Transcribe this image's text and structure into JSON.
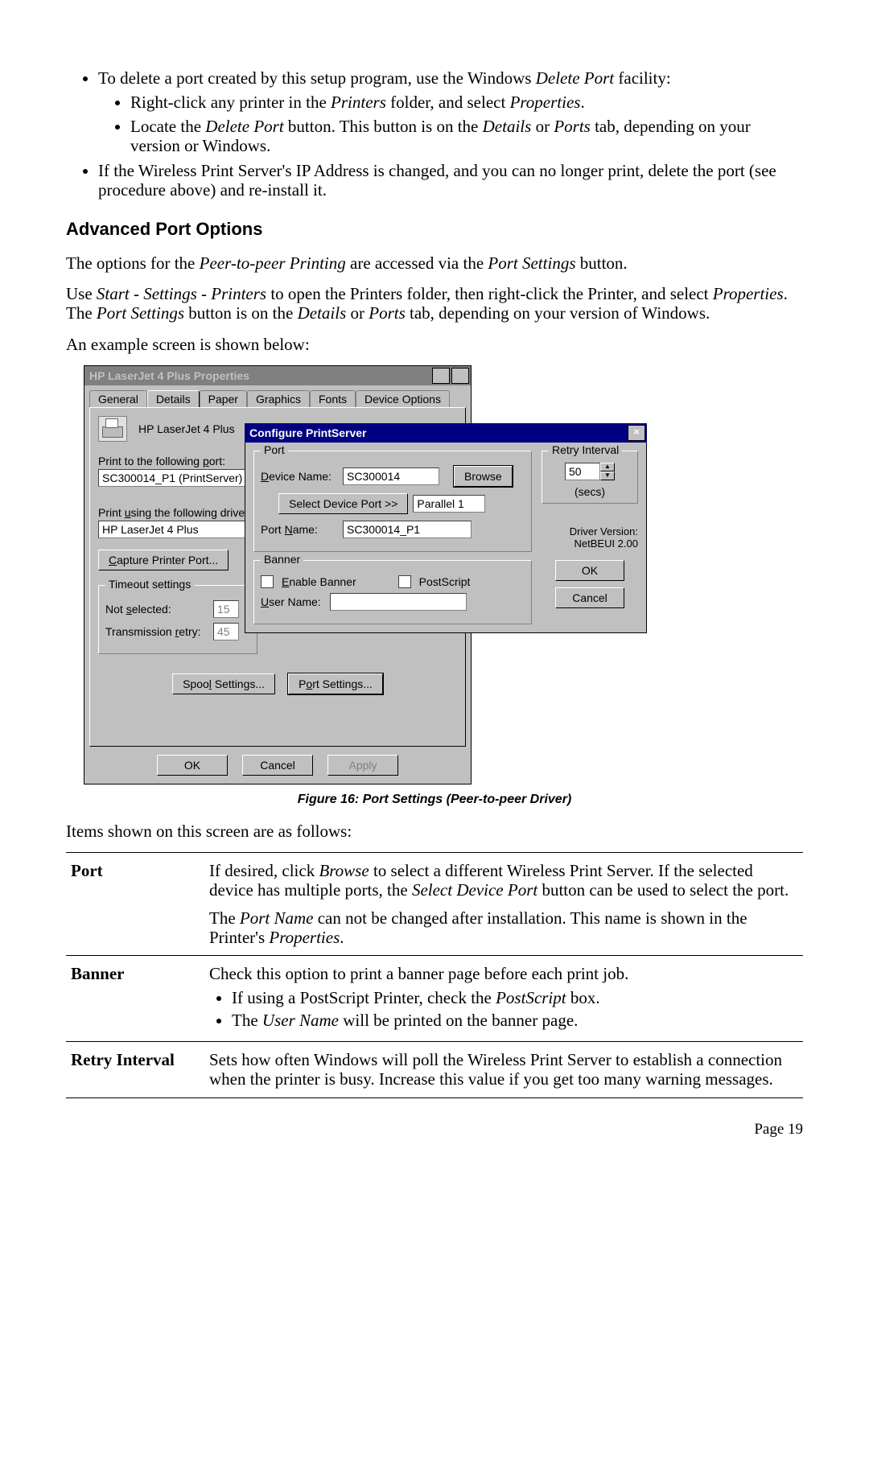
{
  "top_list": {
    "item1_pre": "To delete a port created by this setup program, use the Windows ",
    "item1_it": "Delete Port",
    "item1_post": " facility:",
    "sub1_pre": "Right-click any printer in the ",
    "sub1_it1": "Printers",
    "sub1_mid": " folder, and select ",
    "sub1_it2": "Properties",
    "sub1_post": ".",
    "sub2_pre": "Locate the ",
    "sub2_it1": "Delete Port",
    "sub2_mid1": " button. This button is on the ",
    "sub2_it2": "Details",
    "sub2_mid2": " or ",
    "sub2_it3": "Ports",
    "sub2_post": " tab, depending on your version or Windows.",
    "item2": "If the Wireless Print Server's IP Address is changed, and you can no longer print, delete the port (see procedure above) and re-install it."
  },
  "section_heading": "Advanced Port Options",
  "para1_pre": "The options for the ",
  "para1_it1": "Peer-to-peer Printing",
  "para1_mid": " are accessed via the ",
  "para1_it2": "Port Settings",
  "para1_post": " button.",
  "para2_pre": "Use ",
  "para2_it1": "Start - Settings - Printers",
  "para2_mid1": " to open the Printers folder, then right-click the Printer, and select ",
  "para2_it2": "Properties",
  "para2_mid2": ". The ",
  "para2_it3": "Port Settings",
  "para2_mid3": " button is on the ",
  "para2_it4": "Details",
  "para2_mid4": " or ",
  "para2_it5": "Ports",
  "para2_post": " tab, depending on your version of Windows.",
  "para3": "An example screen is shown below:",
  "props_window": {
    "title": "HP LaserJet 4 Plus Properties",
    "help_btn": "?",
    "close_btn": "×",
    "tabs": [
      "General",
      "Details",
      "Paper",
      "Graphics",
      "Fonts",
      "Device Options"
    ],
    "printer_name": "HP LaserJet 4 Plus",
    "print_to_label": "Print to the following port:",
    "print_to_value": "SC300014_P1 (PrintServer)",
    "driver_label": "Print using the following driver:",
    "driver_value": "HP LaserJet 4 Plus",
    "capture_btn": "Capture Printer Port...",
    "timeout_legend": "Timeout settings",
    "not_selected_label": "Not selected:",
    "not_selected_value": "15",
    "trans_retry_label": "Transmission retry:",
    "trans_retry_value": "45",
    "spool_btn": "Spool Settings...",
    "port_settings_btn": "Port Settings...",
    "ok_btn": "OK",
    "cancel_btn": "Cancel",
    "apply_btn": "Apply"
  },
  "cfg_window": {
    "title": "Configure PrintServer",
    "close_btn": "×",
    "port_legend": "Port",
    "device_name_label": "Device Name:",
    "device_name_value": "SC300014",
    "browse_btn": "Browse",
    "select_port_btn": "Select Device Port >>",
    "select_port_value": "Parallel 1",
    "port_name_label": "Port Name:",
    "port_name_value": "SC300014_P1",
    "banner_legend": "Banner",
    "enable_banner": "Enable Banner",
    "postscript": "PostScript",
    "user_name_label": "User Name:",
    "retry_legend": "Retry Interval",
    "retry_value": "50",
    "secs": "(secs)",
    "driver_version_label": "Driver Version:",
    "driver_version_value": "NetBEUI   2.00",
    "ok_btn": "OK",
    "cancel_btn": "Cancel"
  },
  "caption": "Figure 16: Port Settings (Peer-to-peer Driver)",
  "items_intro": "Items shown on this screen are as follows:",
  "table": {
    "port_h": "Port",
    "port_p1_pre": "If desired, click ",
    "port_p1_it1": "Browse",
    "port_p1_mid1": " to select a different Wireless Print Server. If the selected device has multiple ports, the ",
    "port_p1_it2": "Select Device Port",
    "port_p1_post": " button can be used to select the port.",
    "port_p2_pre": "The ",
    "port_p2_it1": "Port Name",
    "port_p2_mid": " can not be changed after installation. This name is shown in the Printer's ",
    "port_p2_it2": "Properties",
    "port_p2_post": ".",
    "banner_h": "Banner",
    "banner_p1": "Check this option to print a banner page before each print job.",
    "banner_li1_pre": "If using a PostScript Printer, check the ",
    "banner_li1_it": "PostScript",
    "banner_li1_post": " box.",
    "banner_li2_pre": "The ",
    "banner_li2_it": "User Name",
    "banner_li2_post": " will be printed on the banner page.",
    "retry_h": "Retry Interval",
    "retry_p": "Sets how often Windows will poll the Wireless Print Server to establish a connection when the printer is busy. Increase this value if you get too many warning messages."
  },
  "page_num": "Page 19"
}
